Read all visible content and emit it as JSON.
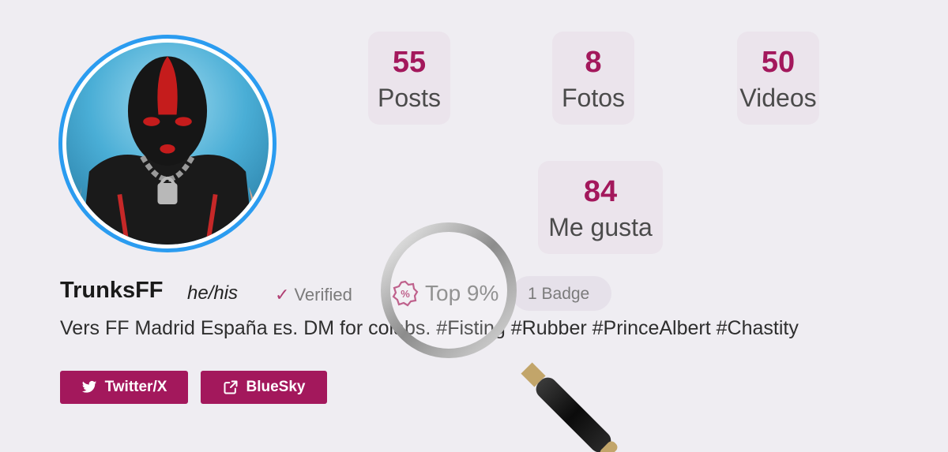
{
  "profile": {
    "username": "TrunksFF",
    "pronouns": "he/his",
    "verified_label": "Verified",
    "top_badge": "Top 9%",
    "badge_count": "1 Badge",
    "bio": "Vers FF Madrid España ᴇs. DM for colabs. #Fisting #Rubber #PrinceAlbert #Chastity"
  },
  "stats": {
    "posts": {
      "value": "55",
      "label": "Posts"
    },
    "fotos": {
      "value": "8",
      "label": "Fotos"
    },
    "videos": {
      "value": "50",
      "label": "Videos"
    },
    "likes": {
      "value": "84",
      "label": "Me gusta"
    }
  },
  "social": {
    "twitter_label": "Twitter/X",
    "bluesky_label": "BlueSky"
  },
  "colors": {
    "accent": "#a3185c",
    "avatar_ring": "#2b9cf0",
    "background": "#efedf2"
  },
  "icons": [
    "twitter-icon",
    "external-link-icon",
    "checkmark-icon",
    "badge-icon",
    "magnifying-glass"
  ]
}
